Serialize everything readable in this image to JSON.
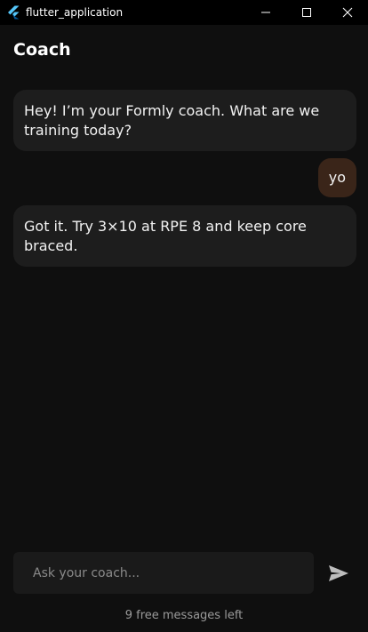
{
  "window": {
    "title": "flutter_application",
    "logo_icon": "flutter-logo-icon",
    "controls": [
      "minimize-icon",
      "maximize-icon",
      "close-icon"
    ]
  },
  "header": {
    "title": "Coach"
  },
  "messages": [
    {
      "role": "coach",
      "text": "Hey! I’m your Formly coach. What are we training today?"
    },
    {
      "role": "user",
      "text": "yo"
    },
    {
      "role": "coach",
      "text": "Got it. Try 3×10 at RPE 8 and keep core braced."
    }
  ],
  "composer": {
    "placeholder": "Ask your coach...",
    "value": "",
    "send_icon": "send-icon"
  },
  "footer": {
    "quota_text": "9 free messages left"
  },
  "colors": {
    "background": "#0f0f0f",
    "titlebar": "#000000",
    "coach_bubble": "#1d1d1d",
    "user_bubble": "#3a2519",
    "composer": "#1a1a1a"
  }
}
